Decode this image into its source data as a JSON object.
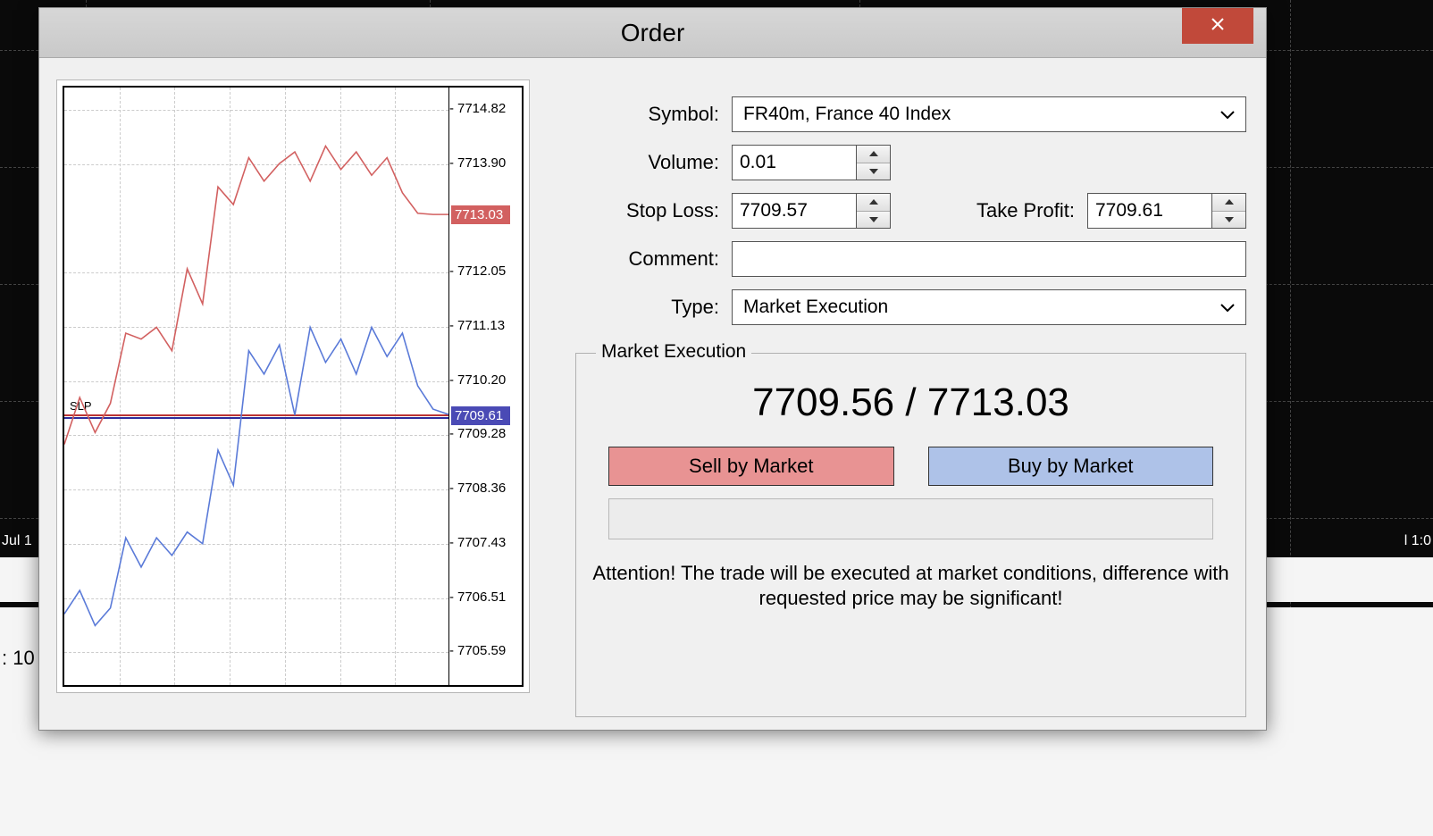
{
  "bg": {
    "date_label": "Jul 1",
    "right_time": "l 1:0",
    "bottom_left": ": 10"
  },
  "dialog": {
    "title": "Order",
    "close_name": "Close"
  },
  "form": {
    "symbol_label": "Symbol:",
    "symbol_value": "FR40m, France 40 Index",
    "volume_label": "Volume:",
    "volume_value": "0.01",
    "stoploss_label": "Stop Loss:",
    "stoploss_value": "7709.57",
    "takeprofit_label": "Take Profit:",
    "takeprofit_value": "7709.61",
    "comment_label": "Comment:",
    "comment_value": "",
    "type_label": "Type:",
    "type_value": "Market Execution"
  },
  "execution": {
    "legend": "Market Execution",
    "bid": "7709.56",
    "ask": "7713.03",
    "price_separator": " / ",
    "sell_label": "Sell by Market",
    "buy_label": "Buy by Market",
    "warning": "Attention! The trade will be executed at market conditions, difference with requested price may be significant!"
  },
  "chart_data": {
    "type": "line",
    "y_ticks": [
      7714.82,
      7713.9,
      7712.05,
      7711.13,
      7710.2,
      7709.28,
      7708.36,
      7707.43,
      7706.51,
      7705.59
    ],
    "ask_marker": 7713.03,
    "bid_marker": 7709.61,
    "sl_tp_label": "SLP",
    "y_range": [
      7705.0,
      7715.2
    ],
    "series": [
      {
        "name": "ask",
        "color": "#d26060",
        "values": [
          7709.1,
          7709.9,
          7709.3,
          7709.8,
          7711.0,
          7710.9,
          7711.1,
          7710.7,
          7712.1,
          7711.5,
          7713.5,
          7713.2,
          7714.0,
          7713.6,
          7713.9,
          7714.1,
          7713.6,
          7714.2,
          7713.8,
          7714.1,
          7713.7,
          7714.0,
          7713.4,
          7713.05,
          7713.03,
          7713.03
        ]
      },
      {
        "name": "bid",
        "color": "#5a7ad8",
        "values": [
          7706.2,
          7706.6,
          7706.0,
          7706.3,
          7707.5,
          7707.0,
          7707.5,
          7707.2,
          7707.6,
          7707.4,
          7709.0,
          7708.4,
          7710.7,
          7710.3,
          7710.8,
          7709.6,
          7711.1,
          7710.5,
          7710.9,
          7710.3,
          7711.1,
          7710.6,
          7711.0,
          7710.1,
          7709.7,
          7709.61
        ]
      }
    ]
  }
}
